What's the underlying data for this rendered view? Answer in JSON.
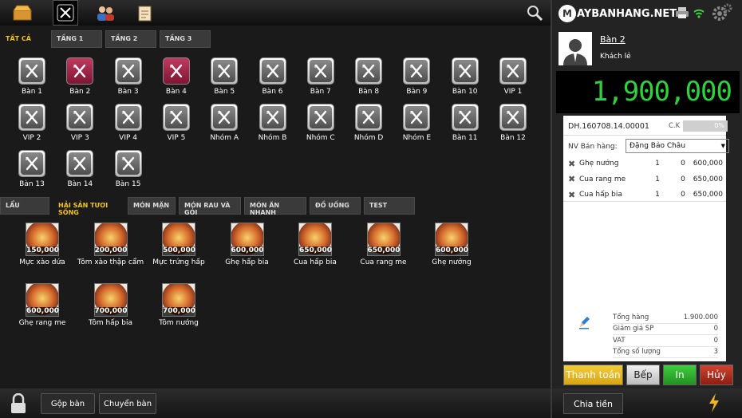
{
  "top_icons": [
    "box-icon",
    "fork-knife-icon",
    "users-icon",
    "clipboard-icon",
    "search-icon"
  ],
  "table_tabs": [
    "TẤT CẢ",
    "TẦNG 1",
    "TẦNG 2",
    "TẦNG 3"
  ],
  "tables": [
    {
      "label": "Bàn 1",
      "busy": false
    },
    {
      "label": "Bàn 2",
      "busy": true
    },
    {
      "label": "Bàn 3",
      "busy": false
    },
    {
      "label": "Bàn 4",
      "busy": true
    },
    {
      "label": "Bàn 5",
      "busy": false
    },
    {
      "label": "Bàn 6",
      "busy": false
    },
    {
      "label": "Bàn 7",
      "busy": false
    },
    {
      "label": "Bàn 8",
      "busy": false
    },
    {
      "label": "Bàn 9",
      "busy": false
    },
    {
      "label": "Bàn 10",
      "busy": false
    },
    {
      "label": "VIP 1",
      "busy": false
    },
    {
      "label": "VIP 2",
      "busy": false
    },
    {
      "label": "VIP 3",
      "busy": false
    },
    {
      "label": "VIP 4",
      "busy": false
    },
    {
      "label": "VIP 5",
      "busy": false
    },
    {
      "label": "Nhóm A",
      "busy": false
    },
    {
      "label": "Nhóm B",
      "busy": false
    },
    {
      "label": "Nhóm C",
      "busy": false
    },
    {
      "label": "Nhóm D",
      "busy": false
    },
    {
      "label": "Nhóm E",
      "busy": false
    },
    {
      "label": "Bàn 11",
      "busy": false
    },
    {
      "label": "Bàn 12",
      "busy": false
    },
    {
      "label": "Bàn 13",
      "busy": false
    },
    {
      "label": "Bàn 14",
      "busy": false
    },
    {
      "label": "Bàn 15",
      "busy": false
    }
  ],
  "menu_tabs": [
    "LẨU",
    "HẢI SẢN TƯƠI SỐNG",
    "MÓN MẶN",
    "MÓN RAU VÀ GỎI",
    "MÓN ĂN NHANH",
    "ĐỒ UỐNG",
    "TEST"
  ],
  "menu_active": 1,
  "foods": [
    {
      "name": "Mực xào dứa",
      "price": "150,000"
    },
    {
      "name": "Tôm xào thập cẩm",
      "price": "200,000"
    },
    {
      "name": "Mực trứng hấp",
      "price": "500,000"
    },
    {
      "name": "Ghẹ hấp bia",
      "price": "600,000"
    },
    {
      "name": "Cua hấp bia",
      "price": "650,000"
    },
    {
      "name": "Cua rang me",
      "price": "650,000"
    },
    {
      "name": "Ghẹ nướng",
      "price": "600,000"
    },
    {
      "name": "Ghẹ rang me",
      "price": "600,000"
    },
    {
      "name": "Tôm hấp bia",
      "price": "700,000"
    },
    {
      "name": "Tôm nướng",
      "price": "700,000"
    }
  ],
  "bottom": {
    "merge": "Gộp bàn",
    "move": "Chuyển bàn"
  },
  "brand": {
    "m": "M",
    "text": "AYBANHANG.NET"
  },
  "customer": {
    "table": "Bàn 2",
    "name": "Khách lẻ"
  },
  "total_display": "1,900,000",
  "order": {
    "code": "DH.160708.14.00001",
    "ck_label": "C.K",
    "ck_value": "0%",
    "staff_label": "NV Bán hàng:",
    "staff": "Đặng Bảo Châu",
    "items": [
      {
        "name": "Ghẹ nướng",
        "qty": "1",
        "disc": "0",
        "amount": "600,000"
      },
      {
        "name": "Cua rang me",
        "qty": "1",
        "disc": "0",
        "amount": "650,000"
      },
      {
        "name": "Cua hấp bia",
        "qty": "1",
        "disc": "0",
        "amount": "650,000"
      }
    ],
    "summary": [
      {
        "label": "Tổng hàng",
        "value": "1.900.000"
      },
      {
        "label": "Giảm giá SP",
        "value": "0"
      },
      {
        "label": "VAT",
        "value": "0"
      },
      {
        "label": "Tổng số lượng",
        "value": "3"
      }
    ]
  },
  "actions": {
    "pay": "Thanh toán",
    "kitchen": "Bếp",
    "print": "In",
    "cancel": "Hủy",
    "split": "Chia tiền"
  },
  "colors": {
    "accent": "#f0c419",
    "busy_table": "#a8284b",
    "total_digits": "#2dd23c",
    "pay": "#e0b41a",
    "print": "#2f9b2a",
    "cancel": "#b52a1f"
  }
}
